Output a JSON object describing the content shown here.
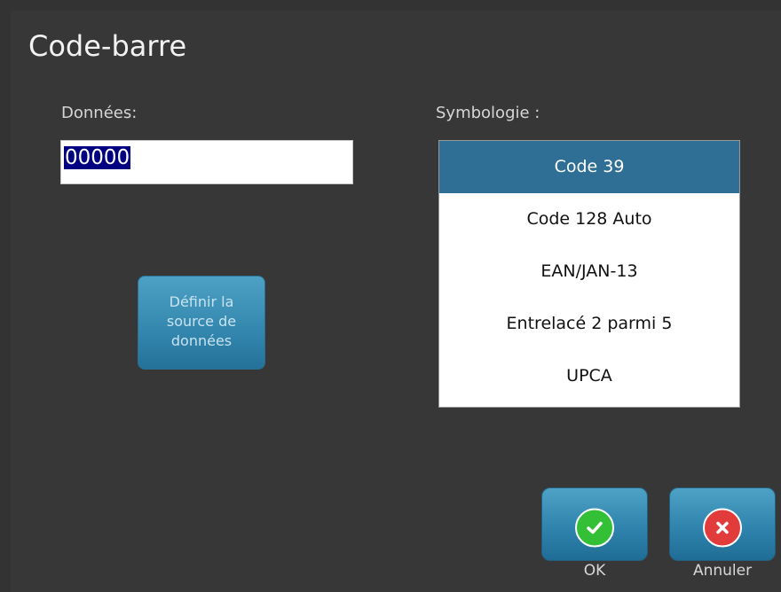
{
  "dialog": {
    "title": "Code-barre"
  },
  "data_field": {
    "label": "Données:",
    "value": "00000"
  },
  "source_button": {
    "label": "Définir la\nsource de\ndonnées"
  },
  "symbology": {
    "label": "Symbologie :",
    "selected": "Code 39",
    "options": [
      "Code 39",
      "Code 128 Auto",
      "EAN/JAN-13",
      "Entrelacé 2 parmi 5",
      "UPCA"
    ]
  },
  "actions": {
    "ok_label": "OK",
    "cancel_label": "Annuler"
  },
  "icons": {
    "ok": "check-icon",
    "cancel": "close-icon"
  },
  "colors": {
    "background": "#373737",
    "selection": "#2f6e95",
    "button": "#3589b0",
    "ok_icon": "#33bf36",
    "cancel_icon": "#e23b3b"
  }
}
